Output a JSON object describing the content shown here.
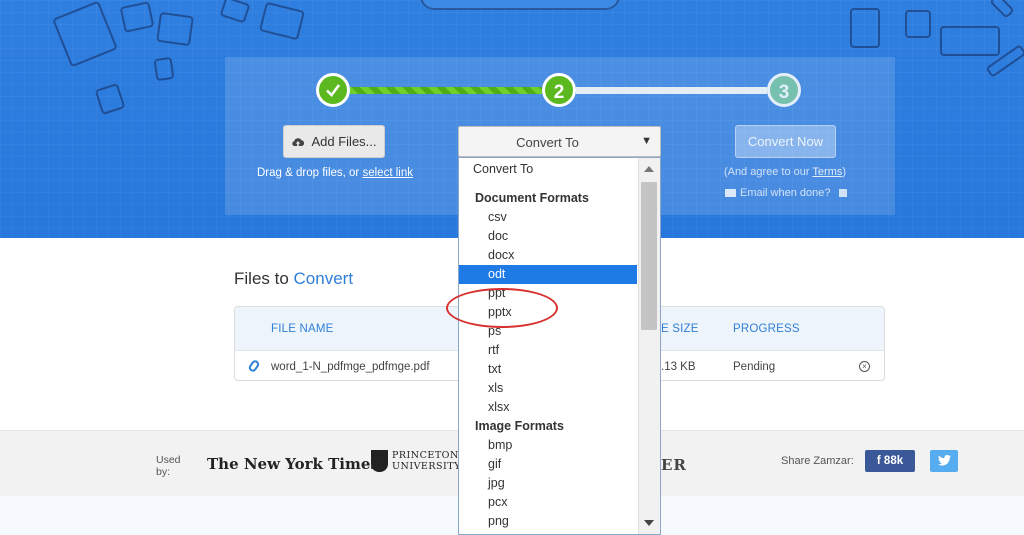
{
  "steps": [
    "2",
    "3"
  ],
  "step1": {
    "add_files_label": "Add Files...",
    "drag_text": "Drag & drop files, or",
    "select_link": "select link"
  },
  "step2": {
    "select_value": "Convert To"
  },
  "step3": {
    "convert_now_label": "Convert Now",
    "agree_prefix": "(And agree to our",
    "terms_link": "Terms",
    "agree_suffix": ")",
    "email_label": "Email when done?"
  },
  "files": {
    "title_prefix": "Files to",
    "title_accent": "Convert",
    "columns": {
      "file_name": "FILE NAME",
      "file_size": "E SIZE",
      "progress": "PROGRESS"
    },
    "rows": [
      {
        "name": "word_1-N_pdfmge_pdfmge.pdf",
        "size": ".13 KB",
        "status": "Pending"
      }
    ]
  },
  "footer": {
    "used_by_line1": "Used",
    "used_by_line2": "by:",
    "nyt": "The New York Times",
    "princeton_line1": "PRINCETON",
    "princeton_line2": "UNIVERSITY",
    "partial_logo": "ER",
    "share_label": "Share Zamzar:",
    "facebook_count": "88k"
  },
  "dropdown": {
    "first_option": "Convert To",
    "groups": [
      {
        "label": "Document Formats",
        "options": [
          "csv",
          "doc",
          "docx",
          "odt",
          "ppt",
          "pptx",
          "ps",
          "rtf",
          "txt",
          "xls",
          "xlsx"
        ]
      },
      {
        "label": "Image Formats",
        "options": [
          "bmp",
          "gif",
          "jpg",
          "pcx",
          "png"
        ]
      }
    ],
    "selected_option": "odt"
  },
  "colors": {
    "hero_blue": "#2f7fe0",
    "step_green": "#5cb81f",
    "selected_blue": "#1e7be6",
    "accent_text": "#2f7fd7",
    "annotation_red": "#d7312f",
    "facebook": "#3b5998",
    "twitter": "#55acee"
  }
}
